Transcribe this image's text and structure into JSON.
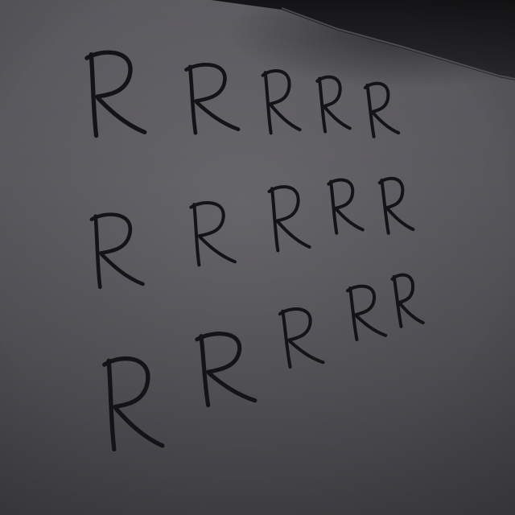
{
  "scene": {
    "subject": "whiteboard",
    "ink_color": "#141418",
    "board_color": "#57565b",
    "frame_color": "#1a1a1c"
  },
  "handwriting": {
    "rows": [
      [
        "R",
        "R",
        "R",
        "R",
        "R"
      ],
      [
        "R",
        "R",
        "R",
        "R",
        "R"
      ],
      [
        "R",
        "R",
        "R",
        "R",
        "R"
      ]
    ]
  }
}
